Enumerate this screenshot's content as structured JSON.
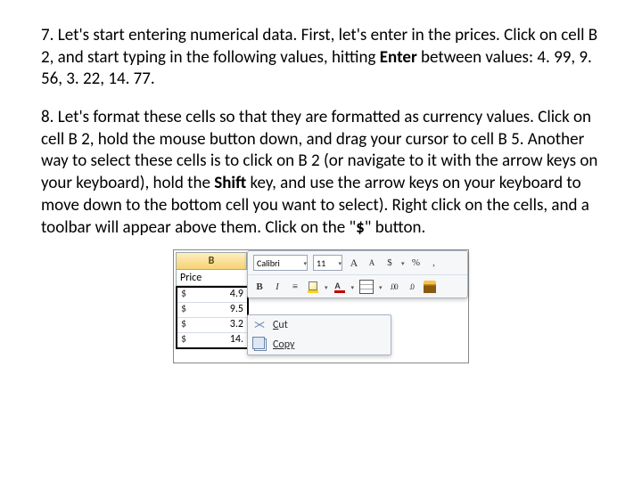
{
  "step7": {
    "num": "7. ",
    "t1": "Let's start entering numerical data. First, let's enter in the prices. Click on cell B 2, and start typing in the following values, hitting ",
    "bold": "Enter",
    "t2": " between values: 4. 99, 9. 56, 3. 22, 14. 77."
  },
  "step8": {
    "num": "8. ",
    "t1": "Let's format these cells so that they are formatted as currency values. Click on cell B 2, hold the mouse button down, and drag your cursor to cell B 5. Another way to select these cells is to click on B 2 (or navigate to it with the arrow keys on your keyboard), hold the ",
    "bold1": "Shift",
    "t2": " key, and use the arrow keys on your keyboard to move down to the bottom cell you want to select). Right click on the cells, and a toolbar will appear above them. Click on the \"",
    "bold2": "$",
    "t3": "\" button."
  },
  "toolbar": {
    "font": "Calibri",
    "size": "11",
    "grow": "A",
    "shrink": "A",
    "dollar": "$",
    "percent": "%",
    "comma": ",",
    "bold": "B",
    "italic": "I",
    "incdec": ".00",
    "decinc": ".0"
  },
  "sheet": {
    "col": "B",
    "label": "Price",
    "rows": [
      {
        "cur": "$",
        "val": "4.9"
      },
      {
        "cur": "$",
        "val": "9.5"
      },
      {
        "cur": "$",
        "val": "3.2"
      },
      {
        "cur": "$",
        "val": "14."
      }
    ]
  },
  "ctx": {
    "cut": "Cut",
    "copy": "Copy"
  }
}
